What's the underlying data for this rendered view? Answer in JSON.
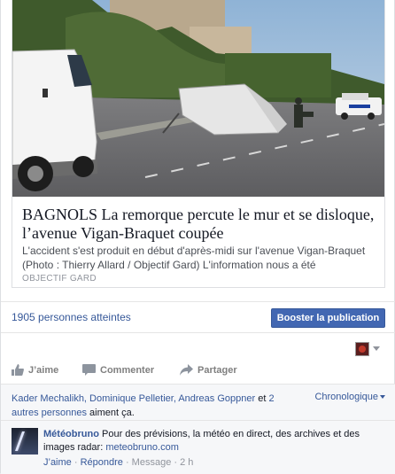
{
  "link_preview": {
    "title": "BAGNOLS La remorque percute le mur et se disloque, l’avenue Vigan-Braquet coupée",
    "description": "L'accident s'est produit en début d'après-midi sur l'avenue Vigan-Braquet (Photo : Thierry Allard / Objectif Gard) L'information nous a été communiquée par un de…",
    "source": "OBJECTIF GARD"
  },
  "reach": {
    "text": "1905 personnes atteintes",
    "boost_label": "Booster la publication"
  },
  "actions": {
    "like": "J’aime",
    "comment": "Commenter",
    "share": "Partager"
  },
  "likes": {
    "names": "Kader Mechalikh, Dominique Pelletier, Andreas Goppner",
    "and": " et ",
    "others": "2 autres personnes",
    "suffix": " aiment ça.",
    "sort_label": "Chronologique"
  },
  "comment": {
    "author": "Météobruno",
    "text": " Pour des prévisions, la météo en direct, des archives et des images radar: ",
    "link": "meteobruno.com",
    "like": "J’aime",
    "sep1": " · ",
    "reply": "Répondre",
    "sep2": " · Message · ",
    "time": "2 h"
  },
  "colors": {
    "accent": "#4267b2",
    "link": "#365899"
  }
}
